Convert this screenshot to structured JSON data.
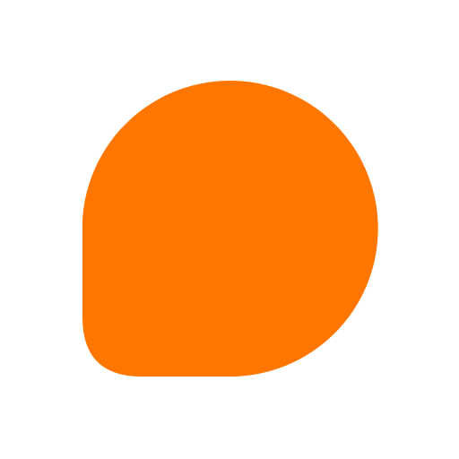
{
  "logo": {
    "icon_name": "speech-bubble-logo-icon",
    "fill_color": "#FF7600",
    "background_color": "#FFFFFF"
  }
}
